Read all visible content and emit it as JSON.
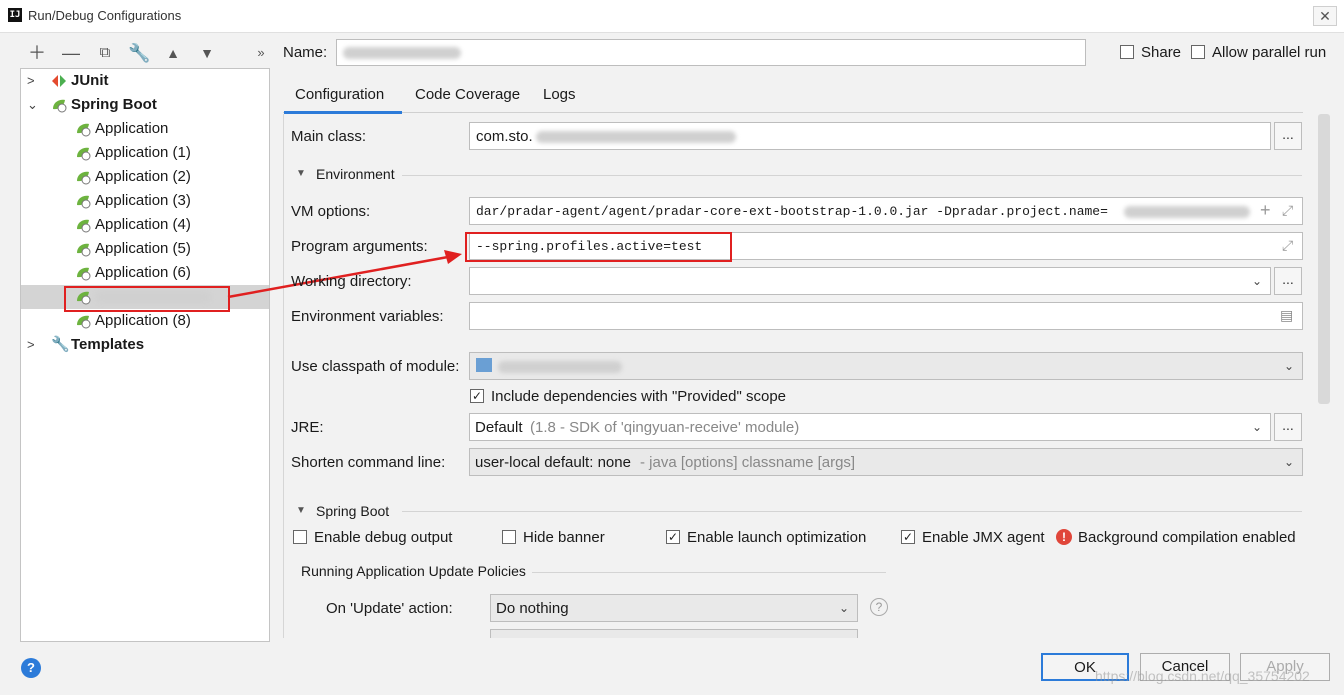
{
  "window": {
    "title": "Run/Debug Configurations",
    "app_icon_text": "IJ",
    "close_glyph": "✕"
  },
  "toolbar": {
    "icons": [
      "add-icon",
      "remove-icon",
      "copy-icon",
      "wrench-icon",
      "move-up-icon",
      "move-down-icon",
      "expand-more-icon"
    ]
  },
  "tree": {
    "junit": "JUnit",
    "spring_boot": "Spring Boot",
    "apps": [
      "Application",
      "Application (1)",
      "Application (2)",
      "Application (3)",
      "Application (4)",
      "Application (5)",
      "Application (6)"
    ],
    "selected_label": "",
    "app8": "Application (8)",
    "templates": "Templates"
  },
  "header": {
    "name_label": "Name:",
    "name_value": "",
    "share_label": "Share",
    "allow_parallel_label": "Allow parallel run"
  },
  "tabs": [
    "Configuration",
    "Code Coverage",
    "Logs"
  ],
  "form": {
    "main_class_label": "Main class:",
    "main_class_value": "com.sto.",
    "environment_label": "Environment",
    "vm_options_label": "VM options:",
    "vm_options_value": "dar/pradar-agent/agent/pradar-core-ext-bootstrap-1.0.0.jar -Dpradar.project.name=",
    "program_args_label": "Program arguments:",
    "program_args_value": "--spring.profiles.active=test",
    "working_dir_label": "Working directory:",
    "env_vars_label": "Environment variables:",
    "classpath_label": "Use classpath of module:",
    "include_deps_label": "Include dependencies with \"Provided\" scope",
    "jre_label": "JRE:",
    "jre_value": "Default",
    "jre_hint": "(1.8 - SDK of 'qingyuan-receive' module)",
    "shorten_label": "Shorten command line:",
    "shorten_value": "user-local default: none",
    "shorten_hint": "- java [options] classname [args]"
  },
  "spring_boot_section": {
    "title": "Spring Boot",
    "debug_output": "Enable debug output",
    "hide_banner": "Hide banner",
    "launch_opt": "Enable launch optimization",
    "jmx_agent": "Enable JMX agent",
    "bg_compilation": "Background compilation enabled",
    "policies_title": "Running Application Update Policies",
    "update_action_label": "On 'Update' action:",
    "update_action_value": "Do nothing"
  },
  "buttons": {
    "ok": "OK",
    "cancel": "Cancel",
    "apply": "Apply",
    "help": "?"
  },
  "watermark": "https://blog.csdn.net/qq_35754202",
  "colors": {
    "highlight_red": "#e02020",
    "accent_blue": "#2c7bd9"
  }
}
